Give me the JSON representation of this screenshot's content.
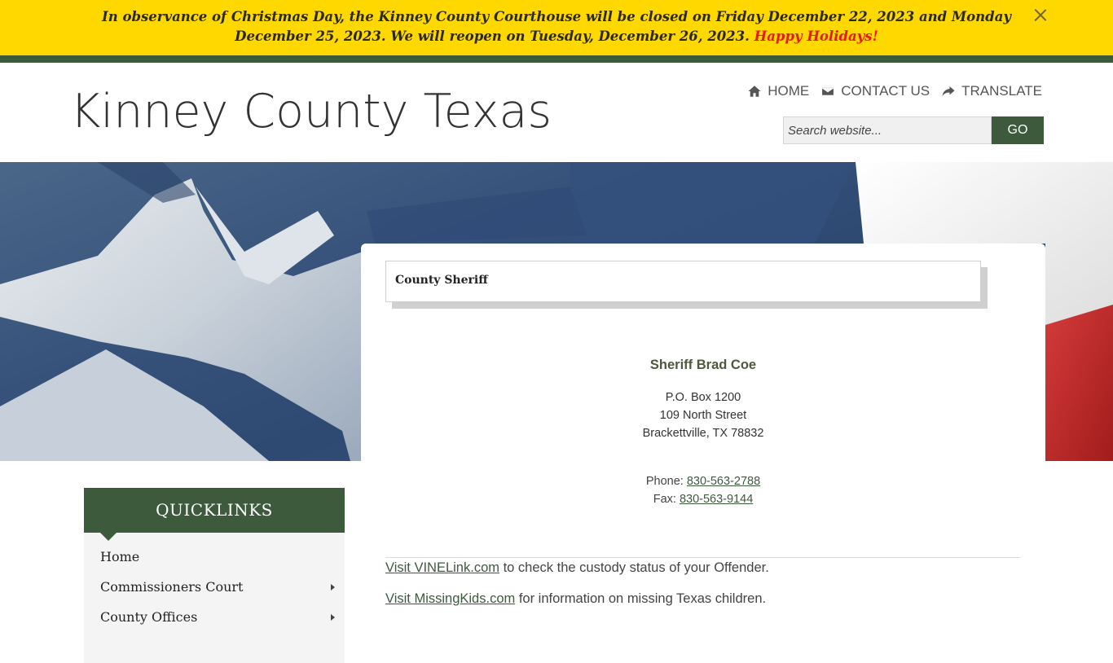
{
  "alert": {
    "message": "In observance of Christmas Day, the Kinney County Courthouse will be closed on Friday December 22, 2023 and Monday December 25, 2023. We will reopen on Tuesday, December 26, 2023.",
    "highlight": "Happy Holidays!",
    "highlight_color": "#e21b1b",
    "background": "#ffd800"
  },
  "header": {
    "site_title": "Kinney County Texas",
    "nav": [
      {
        "label": "HOME",
        "icon": "home-icon"
      },
      {
        "label": "CONTACT US",
        "icon": "envelope-icon"
      },
      {
        "label": "TRANSLATE",
        "icon": "share-arrow-icon"
      }
    ],
    "search": {
      "placeholder": "Search website...",
      "button_label": "GO"
    }
  },
  "colors": {
    "brand_green": "#3d5a3d",
    "text": "#333333"
  },
  "page": {
    "title": "County Sheriff",
    "sheriff_name": "Sheriff Brad Coe",
    "address": [
      "P.O. Box 1200",
      "109 North Street",
      "Brackettville, TX 78832"
    ],
    "phone_label": "Phone:",
    "phone": "830-563-2788",
    "fax_label": "Fax:",
    "fax": "830-563-9144",
    "links": [
      {
        "link_text": "Visit VINELink.com",
        "rest": " to check the custody status of your Offender."
      },
      {
        "link_text": "Visit MissingKids.com",
        "rest": " for information on missing Texas children."
      }
    ]
  },
  "quicklinks": {
    "title": "QUICKLINKS",
    "items": [
      {
        "label": "Home",
        "has_submenu": false
      },
      {
        "label": "Commissioners Court",
        "has_submenu": true
      },
      {
        "label": "County Offices",
        "has_submenu": true
      }
    ]
  }
}
